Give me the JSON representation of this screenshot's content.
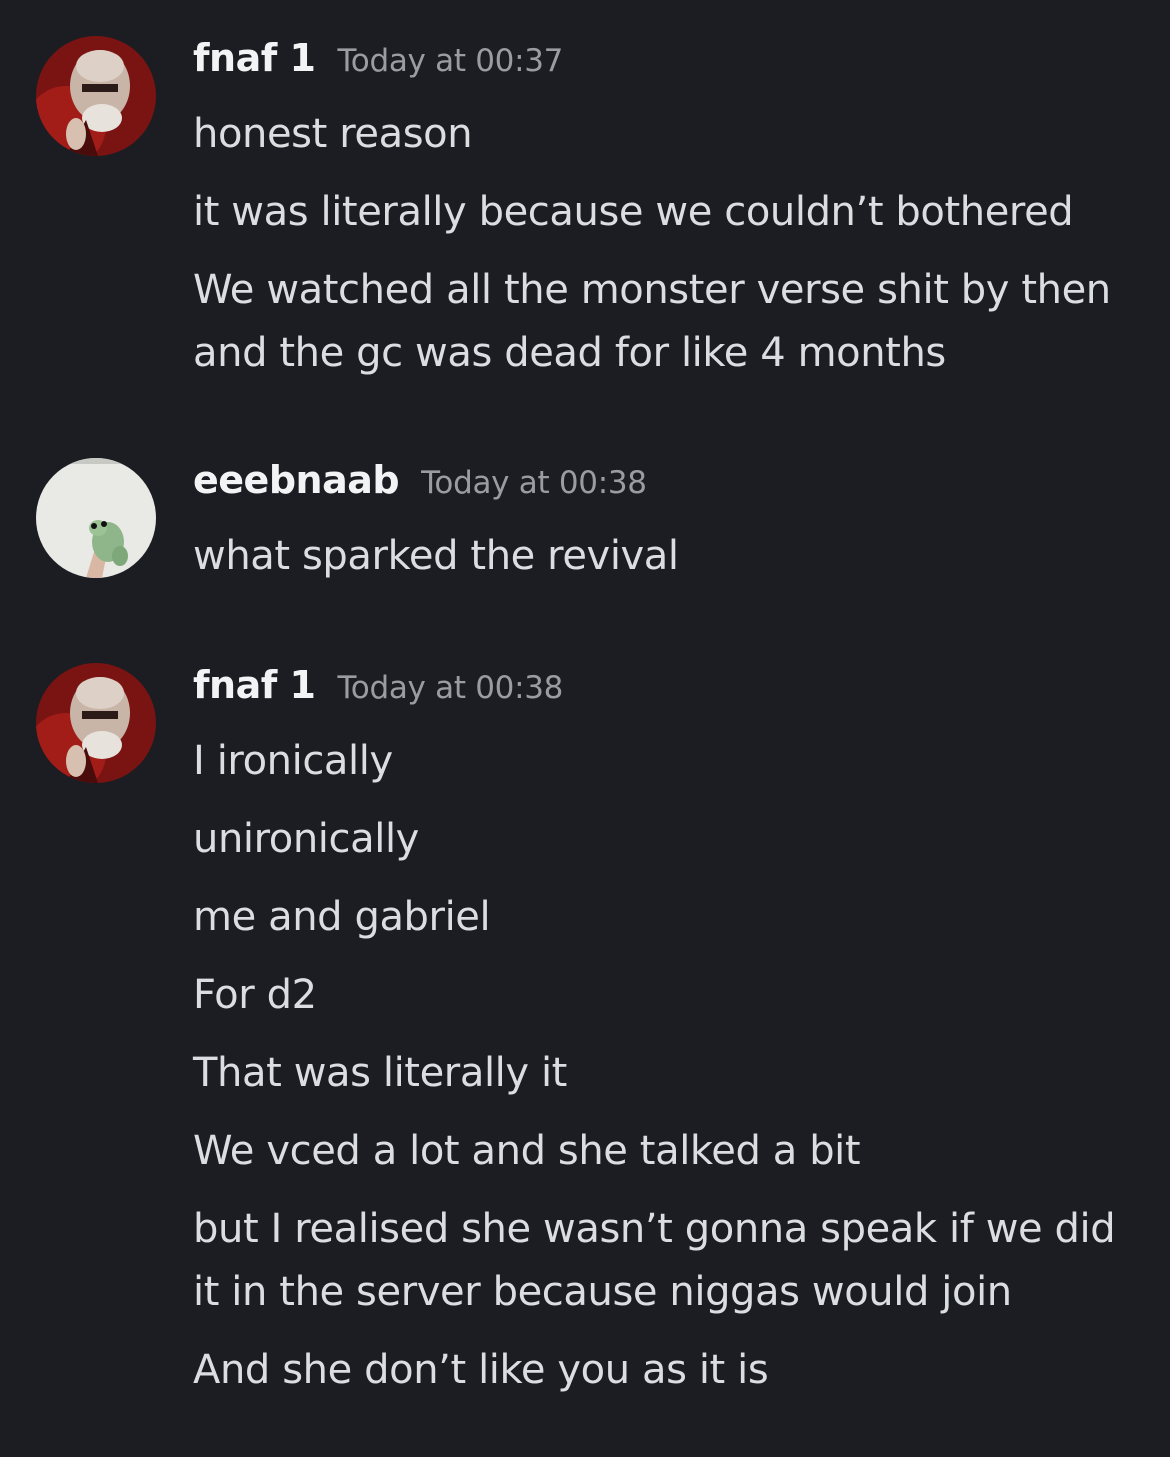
{
  "messages": [
    {
      "username": "fnaf 1",
      "timestamp": "Today at 00:37",
      "avatar_icon": "bald-man-red-avatar-icon",
      "lines": [
        "honest reason",
        "it was literally because we couldn’t bothered",
        "We watched all the monster verse shit by then",
        "and the gc was dead for like 4 months"
      ]
    },
    {
      "username": "eeebnaab",
      "timestamp": "Today at 00:38",
      "avatar_icon": "frog-avatar-icon",
      "lines": [
        "what sparked the revival"
      ]
    },
    {
      "username": "fnaf 1",
      "timestamp": "Today at 00:38",
      "avatar_icon": "bald-man-red-avatar-icon",
      "lines": [
        "I ironically",
        "unironically",
        "me and gabriel",
        "For d2",
        "That was literally it",
        "We vced a lot and she talked a bit",
        "but I realised she wasn’t gonna speak if we did",
        "it in the server because niggas would join",
        "And she don’t like you as it is"
      ]
    }
  ],
  "colors": {
    "background": "#1c1d22",
    "username": "#f2f3f5",
    "timestamp": "#9a9ca3",
    "message_text": "#dbdee1"
  }
}
